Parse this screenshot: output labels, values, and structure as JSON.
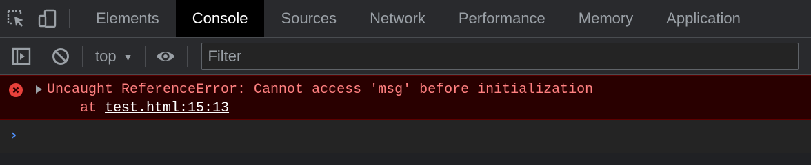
{
  "tabbar": {
    "icons": [
      "inspect-element-icon",
      "device-toolbar-icon"
    ],
    "tabs": [
      {
        "label": "Elements",
        "active": false
      },
      {
        "label": "Console",
        "active": true
      },
      {
        "label": "Sources",
        "active": false
      },
      {
        "label": "Network",
        "active": false
      },
      {
        "label": "Performance",
        "active": false
      },
      {
        "label": "Memory",
        "active": false
      },
      {
        "label": "Application",
        "active": false
      }
    ]
  },
  "toolbar": {
    "icons": [
      "sidebar-toggle-icon",
      "clear-console-icon",
      "eye-icon"
    ],
    "context": "top",
    "filter_placeholder": "Filter",
    "filter_value": ""
  },
  "console": {
    "error": {
      "icon": "error-icon",
      "message": "Uncaught ReferenceError: Cannot access 'msg' before initialization",
      "stack_prefix": "at ",
      "stack_link": "test.html:15:13"
    },
    "prompt_symbol": "›"
  },
  "colors": {
    "active_tab_bg": "#000000",
    "error_bg": "#290000",
    "error_text": "#ff8080",
    "error_icon": "#e8413b",
    "prompt": "#4f8ff7"
  }
}
